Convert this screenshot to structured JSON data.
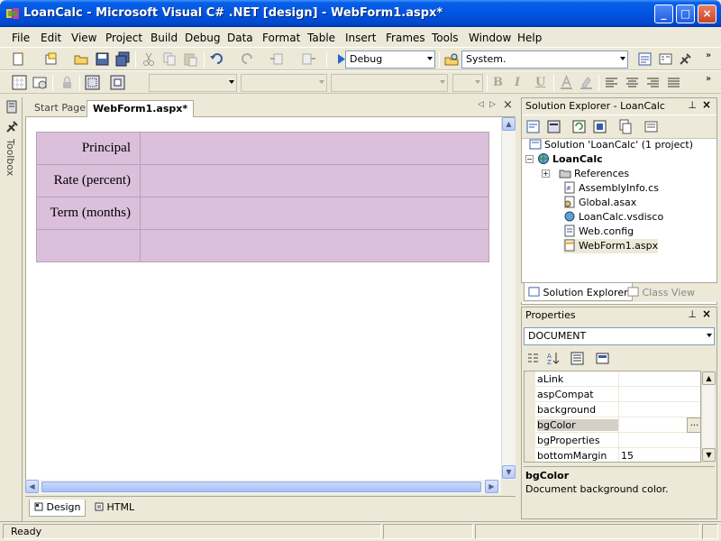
{
  "window": {
    "title": "LoanCalc - Microsoft Visual C# .NET [design] - WebForm1.aspx*",
    "minimize": "_",
    "maximize": "□",
    "close": "×"
  },
  "menu": [
    "File",
    "Edit",
    "View",
    "Project",
    "Build",
    "Debug",
    "Data",
    "Format",
    "Table",
    "Insert",
    "Frames",
    "Tools",
    "Window",
    "Help"
  ],
  "toolbar": {
    "configuration": "Debug",
    "find_value": "System.",
    "format_letters": [
      "B",
      "I",
      "U"
    ]
  },
  "toolbox": {
    "label": "Toolbox"
  },
  "document": {
    "tabs": [
      "Start Page",
      "WebForm1.aspx*"
    ],
    "table_rows": [
      "Principal",
      "Rate (percent)",
      "Term (months)",
      ""
    ],
    "view_tabs": [
      "Design",
      "HTML"
    ]
  },
  "status": {
    "text": "Ready"
  },
  "solution_explorer": {
    "title": "Solution Explorer - LoanCalc",
    "solution": "Solution 'LoanCalc' (1 project)",
    "project": "LoanCalc",
    "items": [
      "References",
      "AssemblyInfo.cs",
      "Global.asax",
      "LoanCalc.vsdisco",
      "Web.config",
      "WebForm1.aspx"
    ],
    "tabs": [
      "Solution Explorer",
      "Class View"
    ]
  },
  "properties": {
    "title": "Properties",
    "object": "DOCUMENT",
    "rows": [
      {
        "name": "aLink",
        "value": ""
      },
      {
        "name": "aspCompat",
        "value": ""
      },
      {
        "name": "background",
        "value": ""
      },
      {
        "name": "bgColor",
        "value": ""
      },
      {
        "name": "bgProperties",
        "value": ""
      },
      {
        "name": "bottomMargin",
        "value": "15"
      }
    ],
    "ellipsis": "...",
    "desc_title": "bgColor",
    "desc_text": "Document background color."
  },
  "colors": {
    "title_blue": "#0054e3",
    "table_fill": "#dbbfdb",
    "chrome": "#ece9d8"
  }
}
